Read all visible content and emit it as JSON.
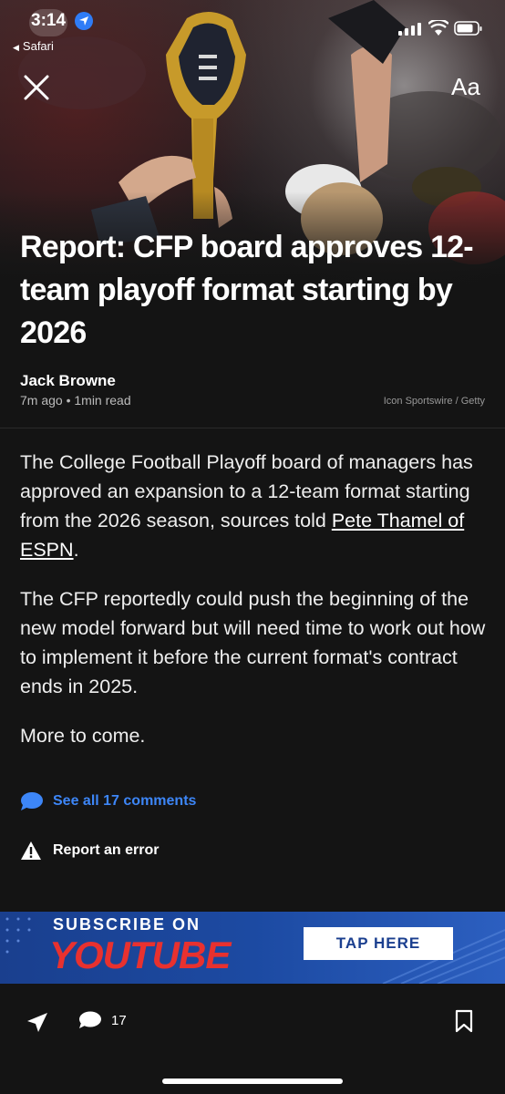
{
  "status_bar": {
    "time": "3:14",
    "back_app": "Safari"
  },
  "header": {
    "text_size_label": "Aa"
  },
  "article": {
    "headline": "Report: CFP board approves 12-team playoff format starting by 2026",
    "author": "Jack Browne",
    "meta": "7m ago • 1min read",
    "photo_credit": "Icon Sportswire / Getty",
    "para1_before_link": "The College Football Playoff board of managers has approved an expansion to a 12-team format starting from the 2026 season, sources told ",
    "para1_link": "Pete Thamel of ESPN",
    "para1_after_link": ".",
    "para2": "The CFP reportedly could push the beginning of the new model forward but will need time to work out how to implement it before the current format's contract ends in 2025.",
    "para3": "More to come."
  },
  "actions": {
    "comments_link": "See all 17 comments",
    "report_error": "Report an error"
  },
  "ad": {
    "line1": "SUBSCRIBE ON",
    "line2": "YOUTUBE",
    "cta": "TAP HERE"
  },
  "bottom_bar": {
    "comment_count": "17"
  },
  "colors": {
    "accent_blue": "#3d86f7",
    "ad_red": "#e8312f",
    "ad_blue": "#1c4aa2",
    "background": "#141414"
  }
}
